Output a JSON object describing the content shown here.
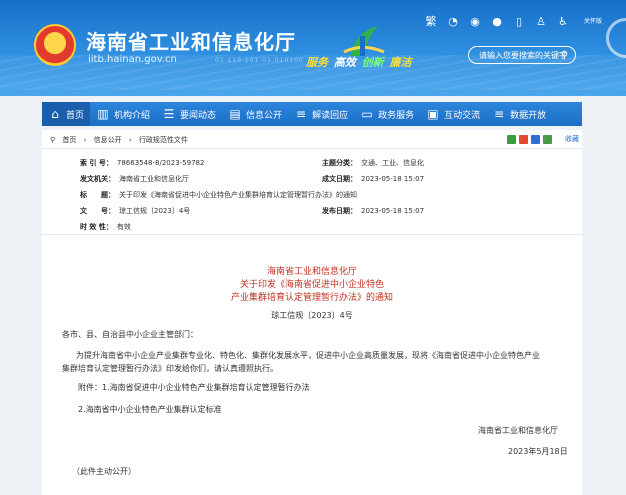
{
  "header": {
    "site_title": "海南省工业和信息化厅",
    "site_domain": "iitb.hainan.gov.cn",
    "binary_text": "01 110 101 01 010100",
    "slogan": [
      "服务",
      "高效",
      "创新",
      "廉洁"
    ],
    "util_text": "关怀版",
    "search_placeholder": "请输入您要搜索的关键字"
  },
  "nav": [
    {
      "label": "首页",
      "icon": "home-icon",
      "glyph": "⌂"
    },
    {
      "label": "机构介绍",
      "icon": "building-icon",
      "glyph": "▥"
    },
    {
      "label": "要闻动态",
      "icon": "news-icon",
      "glyph": "☰"
    },
    {
      "label": "信息公开",
      "icon": "info-icon",
      "glyph": "▤"
    },
    {
      "label": "解读回应",
      "icon": "interpret-icon",
      "glyph": "≡"
    },
    {
      "label": "政务服务",
      "icon": "monitor-icon",
      "glyph": "▭"
    },
    {
      "label": "互动交流",
      "icon": "chat-icon",
      "glyph": "▣"
    },
    {
      "label": "数据开放",
      "icon": "data-icon",
      "glyph": "≡"
    }
  ],
  "breadcrumb": {
    "items": [
      "首页",
      "›",
      "信息公开",
      "›",
      "行政规范性文件"
    ],
    "share_label": "收藏"
  },
  "meta": {
    "index_label": "索 引 号：",
    "index_value": "78663548-8/2023-59782",
    "publisher_label": "发文机关：",
    "publisher_value": "海南省工业和信息化厅",
    "title_label": "标　　题：",
    "title_value": "关于印发《海南省促进中小企业特色产业集群培育认定管理暂行办法》的通知",
    "docno_label": "文　　号：",
    "docno_value": "琼工信规〔2023〕4号",
    "validity_label": "时 效 性：",
    "validity_value": "有效",
    "topic_label": "主题分类：",
    "topic_value": "交通、工业、信息化",
    "created_label": "成文日期：",
    "created_value": "2023-05-18 15:07",
    "published_label": "发布日期：",
    "published_value": "2023-05-18 15:07"
  },
  "document": {
    "heading_line1": "海南省工业和信息化厅",
    "heading_line2": "关于印发《海南省促进中小企业特色",
    "heading_line3": "产业集群培育认定管理暂行办法》的通知",
    "number": "琼工信规〔2023〕4号",
    "salutation": "各市、县、自治县中小企业主管部门：",
    "body_line1": "为提升海南省中小企业产业集群专业化、特色化、集群化发展水平，促进中小企业高质量发展，现将《海南省促进中小企业特色产业",
    "body_line2": "集群培育认定管理暂行办法》印发给你们，请认真遵照执行。",
    "attachment1": "附件：1.海南省促进中小企业特色产业集群培育认定管理暂行办法",
    "attachment2": "2.海南省中小企业特色产业集群认定标准",
    "signature": "海南省工业和信息化厅",
    "date": "2023年5月18日",
    "public_note": "（此件主动公开）"
  }
}
